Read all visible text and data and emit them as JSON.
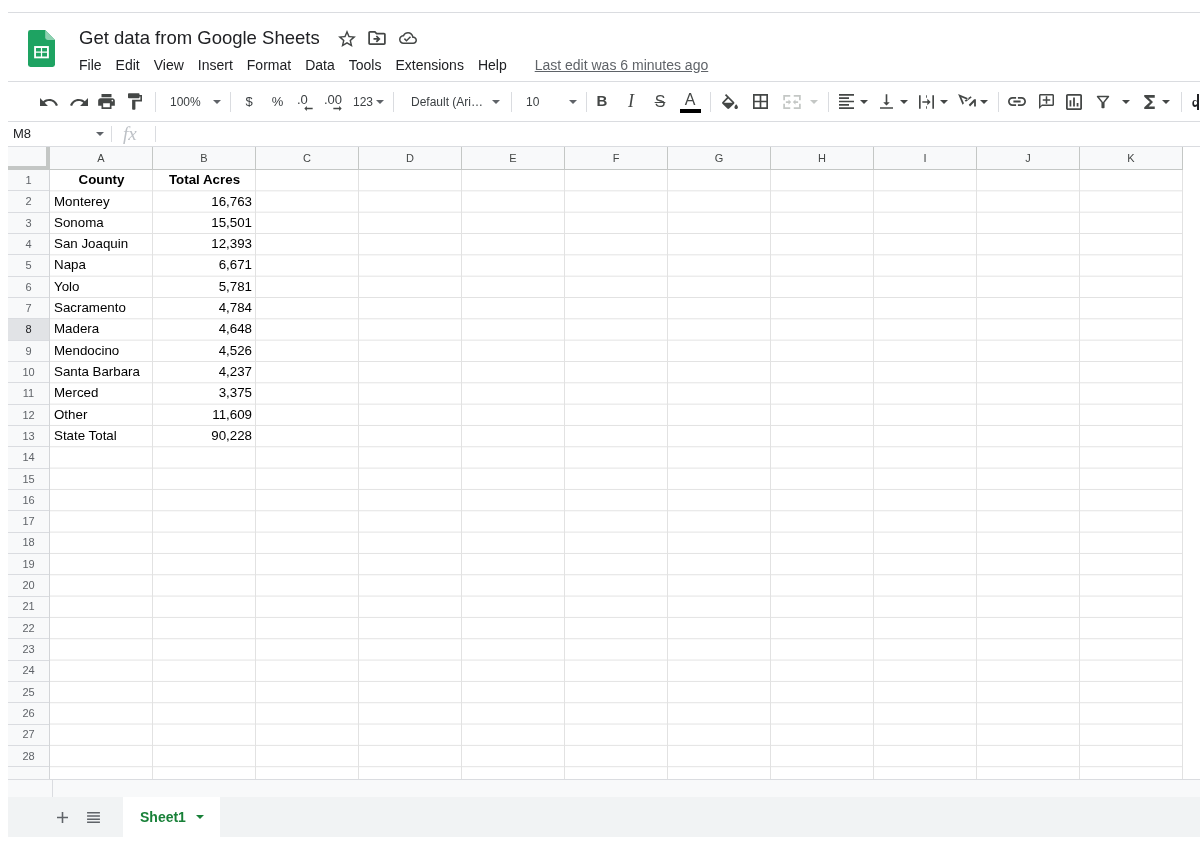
{
  "window": {
    "title": "Get data from Google Sheets"
  },
  "menu": [
    "File",
    "Edit",
    "View",
    "Insert",
    "Format",
    "Data",
    "Tools",
    "Extensions",
    "Help"
  ],
  "last_edit": "Last edit was 6 minutes ago",
  "toolbar": {
    "zoom": "100%",
    "currency": "$",
    "percent": "%",
    "decrease_decimal": ".0",
    "increase_decimal": ".00",
    "number_format": "123",
    "font": "Default (Ari…",
    "font_size": "10",
    "bold": "B",
    "italic": "I",
    "strikethrough": "S",
    "text_color": "A",
    "merge_cells": {
      "disabled": true
    }
  },
  "formula_bar": {
    "cell_reference": "M8",
    "function_label": "fx"
  },
  "grid": {
    "columns": [
      "A",
      "B",
      "C",
      "D",
      "E",
      "F",
      "G",
      "H",
      "I",
      "J",
      "K"
    ],
    "rows": [
      {
        "number": "1",
        "kind": "header",
        "selected": false,
        "cells": [
          "County",
          "Total Acres"
        ]
      },
      {
        "number": "2",
        "kind": "data",
        "selected": false,
        "cells": [
          "Monterey",
          "16,763"
        ]
      },
      {
        "number": "3",
        "kind": "data",
        "selected": false,
        "cells": [
          "Sonoma",
          "15,501"
        ]
      },
      {
        "number": "4",
        "kind": "data",
        "selected": false,
        "cells": [
          "San Joaquin",
          "12,393"
        ]
      },
      {
        "number": "5",
        "kind": "data",
        "selected": false,
        "cells": [
          "Napa",
          "6,671"
        ]
      },
      {
        "number": "6",
        "kind": "data",
        "selected": false,
        "cells": [
          "Yolo",
          "5,781"
        ]
      },
      {
        "number": "7",
        "kind": "data",
        "selected": false,
        "cells": [
          "Sacramento",
          "4,784"
        ]
      },
      {
        "number": "8",
        "kind": "data",
        "selected": true,
        "cells": [
          "Madera",
          "4,648"
        ]
      },
      {
        "number": "9",
        "kind": "data",
        "selected": false,
        "cells": [
          "Mendocino",
          "4,526"
        ]
      },
      {
        "number": "10",
        "kind": "data",
        "selected": false,
        "cells": [
          "Santa Barbara",
          "4,237"
        ]
      },
      {
        "number": "11",
        "kind": "data",
        "selected": false,
        "cells": [
          "Merced",
          "3,375"
        ]
      },
      {
        "number": "12",
        "kind": "data",
        "selected": false,
        "cells": [
          "Other",
          "11,609"
        ]
      },
      {
        "number": "13",
        "kind": "data",
        "selected": false,
        "cells": [
          "State Total",
          "90,228"
        ]
      },
      {
        "number": "14",
        "kind": "empty",
        "selected": false
      },
      {
        "number": "15",
        "kind": "empty",
        "selected": false
      },
      {
        "number": "16",
        "kind": "empty",
        "selected": false
      },
      {
        "number": "17",
        "kind": "empty",
        "selected": false
      },
      {
        "number": "18",
        "kind": "empty",
        "selected": false
      },
      {
        "number": "19",
        "kind": "empty",
        "selected": false
      },
      {
        "number": "20",
        "kind": "empty",
        "selected": false
      },
      {
        "number": "21",
        "kind": "empty",
        "selected": false
      },
      {
        "number": "22",
        "kind": "empty",
        "selected": false
      },
      {
        "number": "23",
        "kind": "empty",
        "selected": false
      },
      {
        "number": "24",
        "kind": "empty",
        "selected": false
      },
      {
        "number": "25",
        "kind": "empty",
        "selected": false
      },
      {
        "number": "26",
        "kind": "empty",
        "selected": false
      },
      {
        "number": "27",
        "kind": "empty",
        "selected": false
      },
      {
        "number": "28",
        "kind": "empty",
        "selected": false
      }
    ]
  },
  "sheet_tabs": [
    {
      "label": "Sheet1",
      "selected": true
    }
  ]
}
